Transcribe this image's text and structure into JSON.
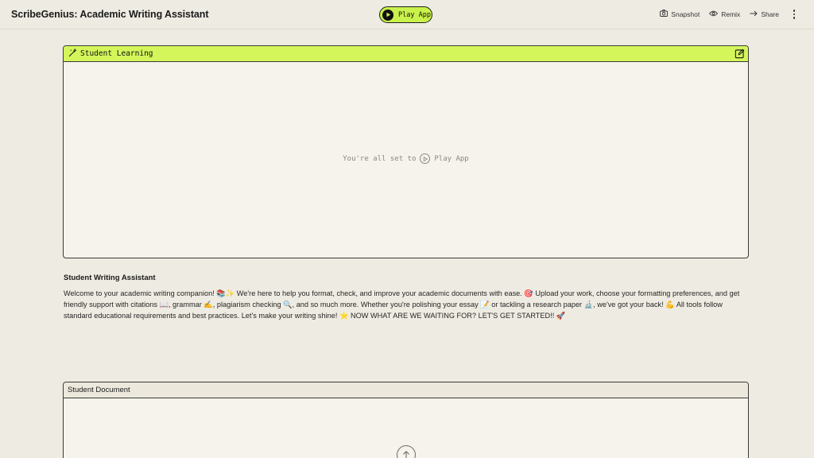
{
  "topbar": {
    "app_title": "ScribeGenius: Academic Writing Assistant",
    "play_label": "Play App",
    "actions": {
      "snapshot": "Snapshot",
      "remix": "Remix",
      "share": "Share"
    }
  },
  "learning_panel": {
    "title": "Student Learning",
    "empty_prefix": "You're all set to",
    "empty_play": "Play App"
  },
  "description": {
    "title": "Student Writing Assistant",
    "body": "Welcome to your academic writing companion! 📚✨ We're here to help you format, check, and improve your academic documents with ease. 🎯 Upload your work, choose your formatting preferences, and get friendly support with citations 📖, grammar ✍️, plagiarism checking 🔍, and so much more. Whether you're polishing your essay 📝 or tackling a research paper 🔬, we've got your back! 💪 All tools follow standard educational requirements and best practices. Let's make your writing shine! ⭐ NOW WHAT ARE WE WAITING FOR? LET'S GET STARTED!! 🚀"
  },
  "document_panel": {
    "title": "Student Document"
  },
  "colors": {
    "accent": "#d4f65b",
    "background": "#eeebe2"
  }
}
